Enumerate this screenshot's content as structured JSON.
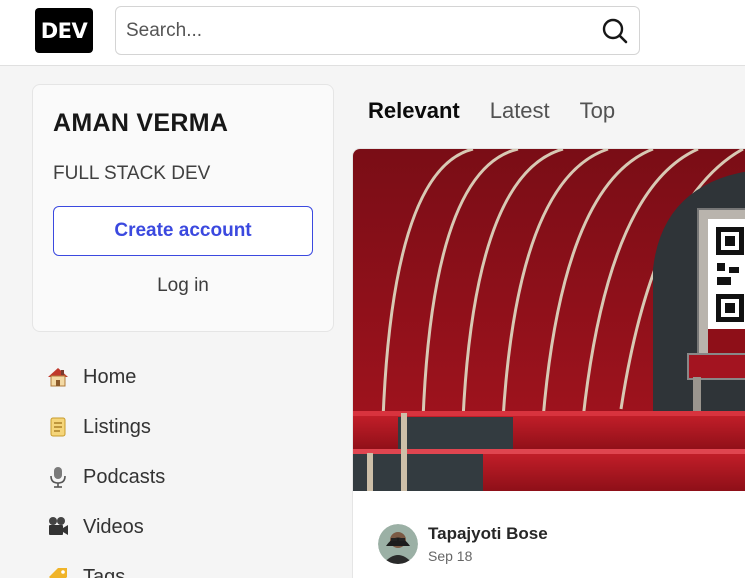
{
  "header": {
    "logo_text": "DEV",
    "search_placeholder": "Search..."
  },
  "card": {
    "title": "AMAN VERMA",
    "subtitle": "FULL STACK DEV",
    "create_label": "Create account",
    "login_label": "Log in"
  },
  "nav": {
    "items": [
      {
        "label": "Home",
        "icon": "house-icon"
      },
      {
        "label": "Listings",
        "icon": "scroll-icon"
      },
      {
        "label": "Podcasts",
        "icon": "microphone-icon"
      },
      {
        "label": "Videos",
        "icon": "movie-camera-icon"
      },
      {
        "label": "Tags",
        "icon": "tag-icon"
      }
    ]
  },
  "feed": {
    "tabs": [
      {
        "label": "Relevant",
        "active": true
      },
      {
        "label": "Latest",
        "active": false
      },
      {
        "label": "Top",
        "active": false
      }
    ]
  },
  "post": {
    "author_name": "Tapajyoti Bose",
    "date": "Sep 18"
  },
  "colors": {
    "accent": "#3b49df",
    "background": "#f5f5f5",
    "card_bg": "#fafafa"
  }
}
